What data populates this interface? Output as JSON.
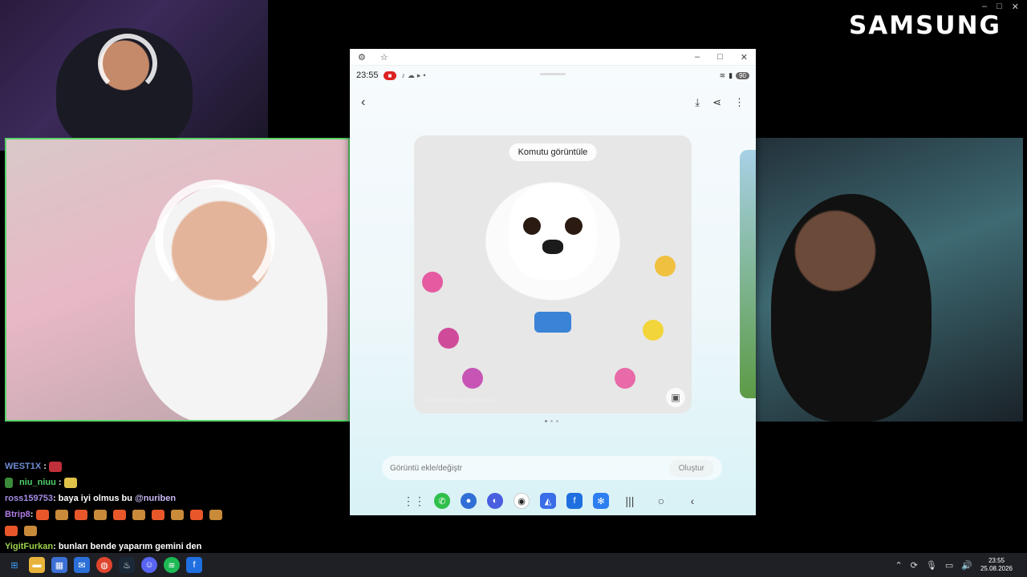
{
  "overlay": {
    "brand": "SAMSUNG"
  },
  "phone_window": {
    "titlebar": {
      "settings_icon": "gear-icon",
      "pin_icon": "star-icon",
      "minimize": "–",
      "maximize": "□",
      "close": "✕"
    },
    "status": {
      "time": "23:55",
      "battery": "90"
    },
    "image_card": {
      "chip_label": "Komutu görüntüle",
      "caption": "AI tarafından oluşturulan iç"
    },
    "prompt": {
      "placeholder": "Görüntü ekle/değiştr",
      "create_label": "Oluştur"
    }
  },
  "chat": [
    {
      "user": "WEST1X",
      "user_color": "#6e8bd4",
      "text": ""
    },
    {
      "user": "niu_niuu",
      "user_color": "#4fd06b",
      "text": ""
    },
    {
      "user": "ross159753",
      "user_color": "#a78de6",
      "text": ": baya iyi olmus bu ",
      "mention": "@nuriben"
    },
    {
      "user": "Btrip8",
      "user_color": "#b07be6",
      "text": ": "
    },
    {
      "user": "YigitFurkan",
      "user_color": "#9bd14a",
      "text": ": bunları bende yaparım gemini den"
    }
  ],
  "taskbar": {
    "time": "23:55",
    "date": "25.08.2026"
  }
}
